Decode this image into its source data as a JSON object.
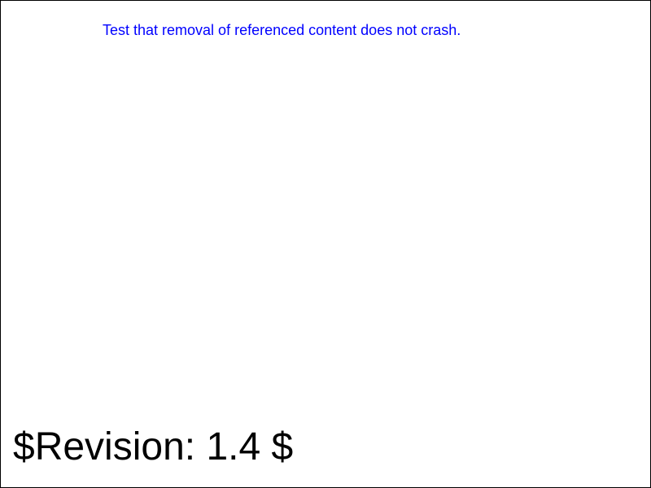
{
  "description": {
    "text": "Test that removal of referenced content does not crash.",
    "color": "#0000ff"
  },
  "revision": {
    "text": "$Revision: 1.4 $"
  },
  "colors": {
    "background": "#ffffff",
    "border": "#000000",
    "revision_text": "#000000"
  }
}
